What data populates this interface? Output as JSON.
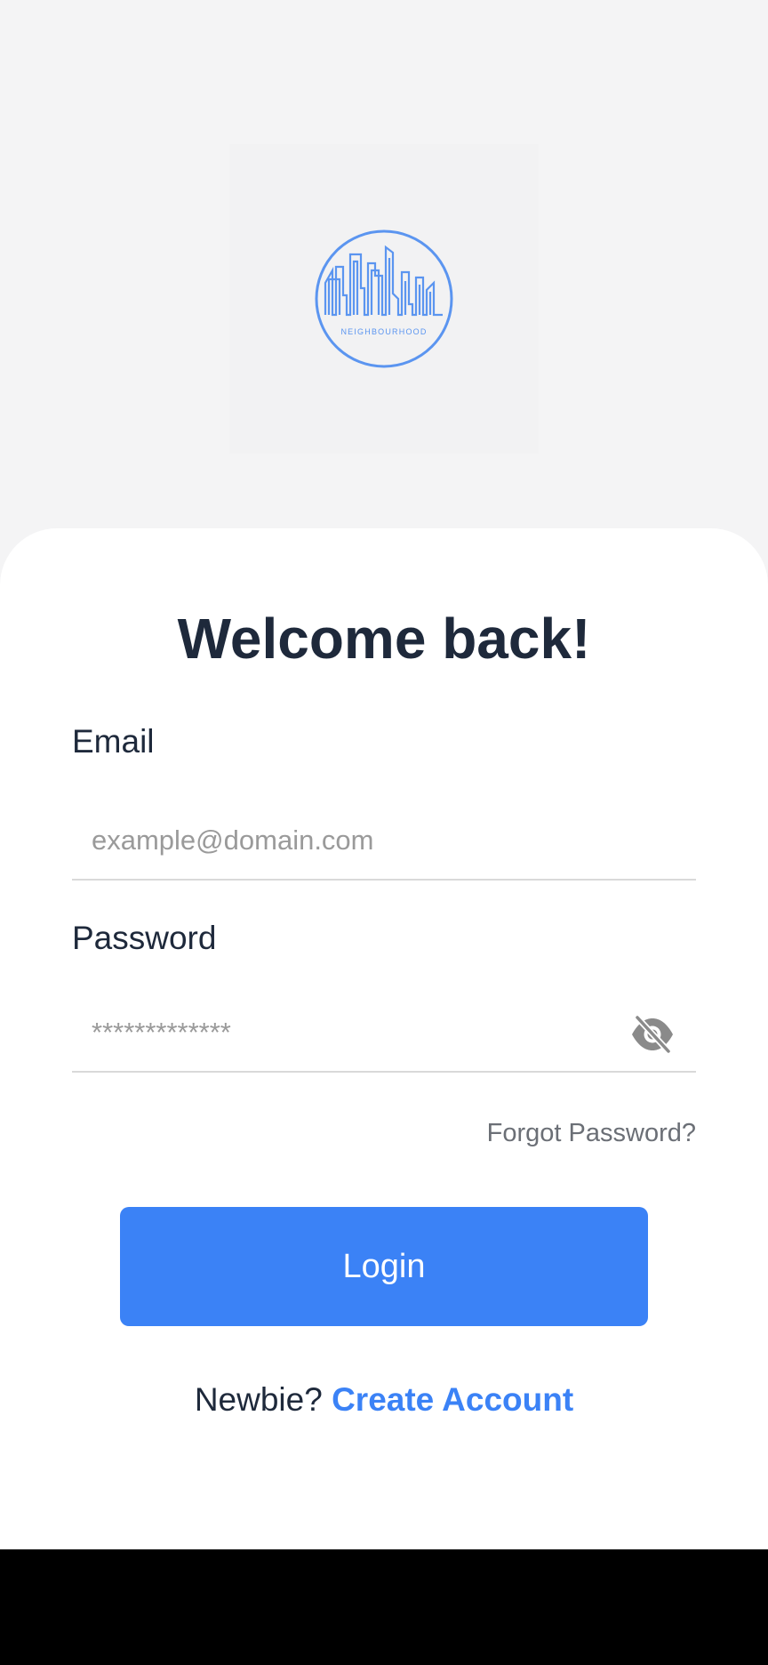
{
  "logo": {
    "icon": "neighbourhood-logo-icon",
    "text": "NEIGHBOURHOOD",
    "color": "#5b95f0"
  },
  "title": "Welcome back!",
  "email": {
    "label": "Email",
    "placeholder": "example@domain.com",
    "value": ""
  },
  "password": {
    "label": "Password",
    "placeholder": "*************",
    "value": "",
    "toggle_icon": "eye-off-icon"
  },
  "forgot_password": "Forgot Password?",
  "login_button": "Login",
  "signup": {
    "prefix": "Newbie?",
    "link": "Create Account"
  },
  "colors": {
    "accent": "#3b82f6",
    "text": "#1e293b",
    "muted": "#6b6f76",
    "background": "#f4f4f5"
  }
}
